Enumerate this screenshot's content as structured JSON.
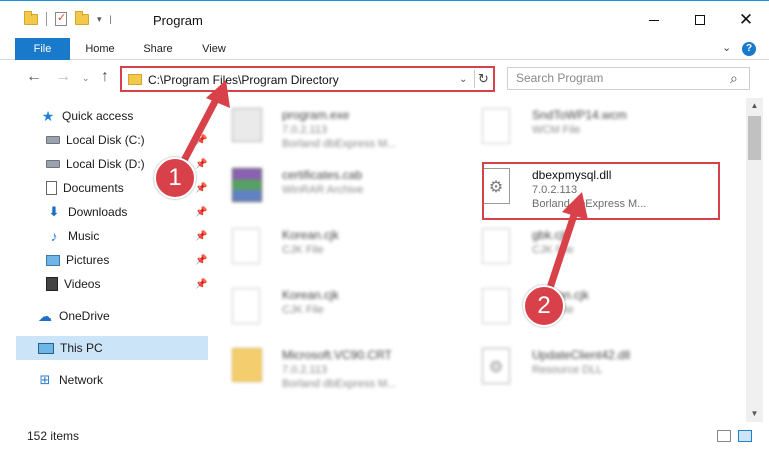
{
  "window": {
    "title": "Program",
    "minimize_glyph": "—",
    "close_glyph": "✕"
  },
  "qat": {
    "dropdown_glyph": "▾",
    "sep_glyph": "|"
  },
  "ribbon": {
    "tabs": [
      {
        "label": "File"
      },
      {
        "label": "Home"
      },
      {
        "label": "Share"
      },
      {
        "label": "View"
      }
    ],
    "expand_glyph": "⌄",
    "help_glyph": "?"
  },
  "nav": {
    "back_glyph": "←",
    "forward_glyph": "→",
    "recent_glyph": "⌄",
    "up_glyph": "↑"
  },
  "address": {
    "path": "C:\\Program Files\\Program Directory",
    "dropdown_glyph": "⌄",
    "refresh_glyph": "↻"
  },
  "search": {
    "placeholder": "Search Program",
    "icon_glyph": "⌕"
  },
  "sidebar": {
    "pin_glyph": "📌",
    "items": [
      {
        "label": "Quick access",
        "icon": "star-icon",
        "pinned": false
      },
      {
        "label": "Local Disk (C:)",
        "icon": "disk-icon",
        "pinned": true
      },
      {
        "label": "Local Disk (D:)",
        "icon": "disk-icon",
        "pinned": true
      },
      {
        "label": "Documents",
        "icon": "documents-icon",
        "pinned": true
      },
      {
        "label": "Downloads",
        "icon": "download-icon",
        "pinned": true
      },
      {
        "label": "Music",
        "icon": "music-icon",
        "pinned": true
      },
      {
        "label": "Pictures",
        "icon": "pictures-icon",
        "pinned": true
      },
      {
        "label": "Videos",
        "icon": "videos-icon",
        "pinned": true
      },
      {
        "label": "OneDrive",
        "icon": "cloud-icon",
        "pinned": false
      },
      {
        "label": "This PC",
        "icon": "computer-icon",
        "pinned": false,
        "selected": true
      },
      {
        "label": "Network",
        "icon": "network-icon",
        "pinned": false
      }
    ],
    "glyphs": {
      "star": "★",
      "download": "⬇",
      "music": "♪",
      "cloud": "☁",
      "network": "⊞"
    }
  },
  "files": [
    {
      "name": "program.exe",
      "line2": "7.0.2.113",
      "line3": "Borland dbExpress M...",
      "icon": "exe-icon"
    },
    {
      "name": "SndToWP14.wcm",
      "line2": "WCM File",
      "line3": "",
      "icon": "document-icon"
    },
    {
      "name": "certificates.cab",
      "line2": "WinRAR Archive",
      "line3": "",
      "icon": "archive-icon"
    },
    {
      "name": "dbexpmysql.dll",
      "line2": "7.0.2.113",
      "line3": "Borland dbExpress M...",
      "icon": "dll-icon",
      "highlighted": true
    },
    {
      "name": "Korean.cjk",
      "line2": "CJK File",
      "line3": "",
      "icon": "document-icon"
    },
    {
      "name": "gbk.cjk",
      "line2": "CJK File",
      "line3": "",
      "icon": "document-icon"
    },
    {
      "name": "Korean.cjk",
      "line2": "CJK File",
      "line3": "",
      "icon": "document-icon"
    },
    {
      "name": "Korean.cjk",
      "line2": "CJK File",
      "line3": "",
      "icon": "document-icon"
    },
    {
      "name": "Microsoft.VC90.CRT",
      "line2": "7.0.2.113",
      "line3": "Borland dbExpress M...",
      "icon": "folder-icon"
    },
    {
      "name": "UpdateClient42.dll",
      "line2": "Resource DLL",
      "line3": "",
      "icon": "dll-icon"
    }
  ],
  "dll_gear_glyph": "⚙",
  "scrollbar": {
    "up_glyph": "▲",
    "down_glyph": "▼"
  },
  "status": {
    "item_count": "152 items"
  },
  "annotations": [
    {
      "number": "1"
    },
    {
      "number": "2"
    }
  ],
  "colors": {
    "accent": "#1979ca",
    "highlight_red": "#d8414a",
    "selection": "#cce4f7"
  }
}
